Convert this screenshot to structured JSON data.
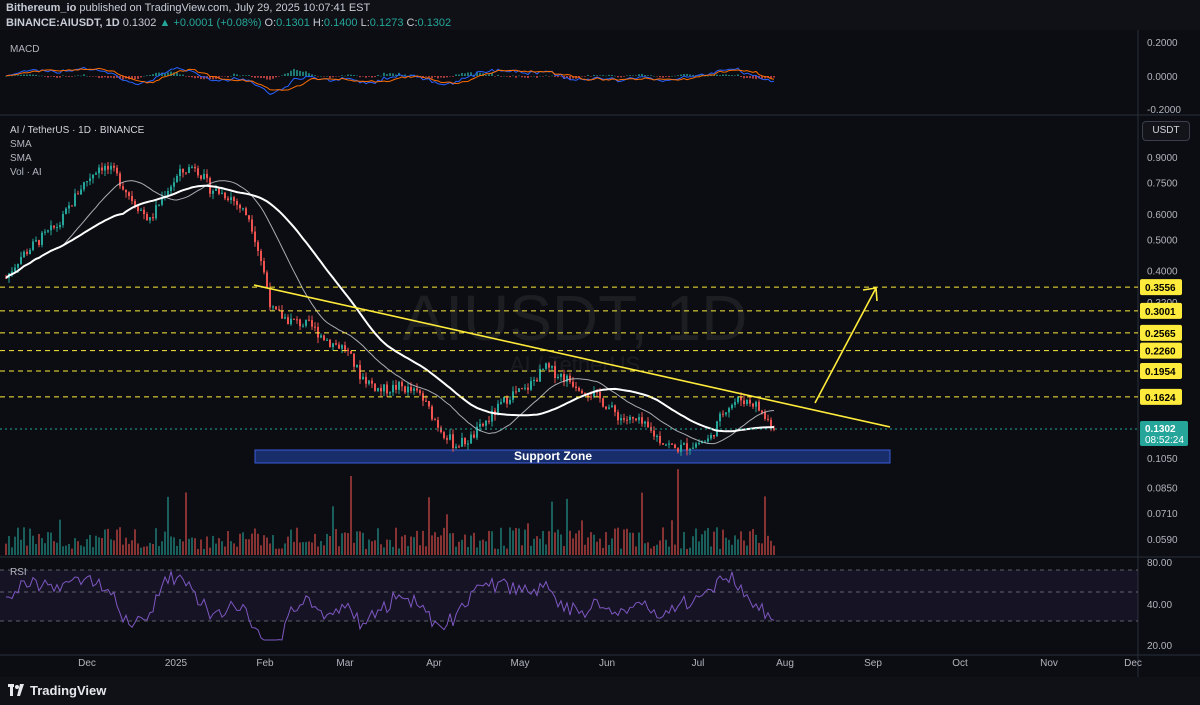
{
  "header": {
    "publisher": "Bithereum_io",
    "published_text": "published on TradingView.com, July 29, 2025 10:07:41 EST",
    "symbol_line": "BINANCE:AIUSDT, 1D",
    "price": "0.1302",
    "change": "▲ +0.0001 (+0.08%)",
    "open": "0.1301",
    "high": "0.1400",
    "low": "0.1273",
    "close": "0.1302",
    "o_label": "O:",
    "h_label": "H:",
    "l_label": "L:",
    "c_label": "C:"
  },
  "macd": {
    "label": "MACD",
    "ticks": [
      "0.2000",
      "0.0000",
      "-0.2000"
    ],
    "colors": {
      "macd": "#2962ff",
      "signal": "#ff6d00",
      "hist_up": "#26a69a",
      "hist_down": "#ef5350"
    }
  },
  "main": {
    "title": "AI / TetherUS · 1D · BINANCE",
    "indicators": [
      "SMA",
      "SMA",
      "Vol · AI"
    ],
    "currency_button": "USDT",
    "watermark": "AIUSDT, 1D",
    "watermark_sub": "AI / TetherUS",
    "price_ticks": [
      "0.9000",
      "0.7500",
      "0.6000",
      "0.5000",
      "0.4000",
      "0.3200",
      "0.1050",
      "0.0850",
      "0.0710",
      "0.0590"
    ],
    "levels": [
      {
        "value": "0.3556",
        "color": "#ffeb3b"
      },
      {
        "value": "0.3001",
        "color": "#ffeb3b"
      },
      {
        "value": "0.2565",
        "color": "#ffeb3b"
      },
      {
        "value": "0.2260",
        "color": "#ffeb3b"
      },
      {
        "value": "0.1954",
        "color": "#ffeb3b"
      },
      {
        "value": "0.1624",
        "color": "#ffeb3b"
      }
    ],
    "last_price": {
      "value": "0.1302",
      "countdown": "08:52:24",
      "color": "#26a69a"
    },
    "support_zone_label": "Support Zone",
    "colors": {
      "up": "#26a69a",
      "down": "#ef5350",
      "trendline": "#ffeb3b",
      "sma_fast": "#d1d4dc",
      "sma_slow": "#ffffff",
      "support": "#1e3a8a"
    }
  },
  "rsi": {
    "label": "RSI",
    "ticks": [
      "80.00",
      "40.00",
      "20.00"
    ],
    "color": "#7e57c2"
  },
  "time_axis": [
    "Dec",
    "2025",
    "Feb",
    "Mar",
    "Apr",
    "May",
    "Jun",
    "Jul",
    "Aug",
    "Sep",
    "Oct",
    "Nov",
    "Dec"
  ],
  "footer": {
    "brand": "TradingView"
  }
}
